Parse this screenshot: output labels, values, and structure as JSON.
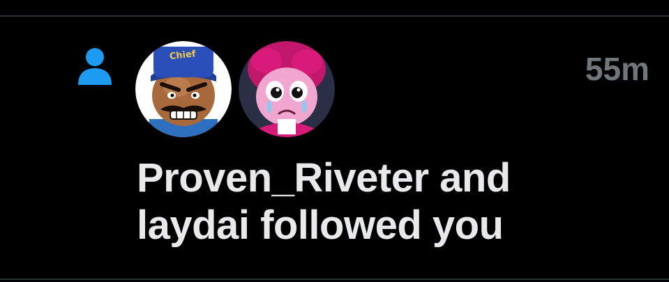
{
  "notification": {
    "type_icon": "person-icon",
    "avatars": [
      {
        "user": "Proven_Riveter",
        "icon": "chief-character-avatar"
      },
      {
        "user": "laydai",
        "icon": "crying-pink-character-avatar"
      }
    ],
    "timestamp": "55m",
    "user_one": "Proven_Riveter",
    "connector": "and",
    "user_two": "laydai",
    "action": "followed you"
  },
  "colors": {
    "background": "#000000",
    "icon_blue": "#1d9bf0",
    "text": "#e7e9ea",
    "muted": "#71767b",
    "divider": "#2f3336"
  }
}
